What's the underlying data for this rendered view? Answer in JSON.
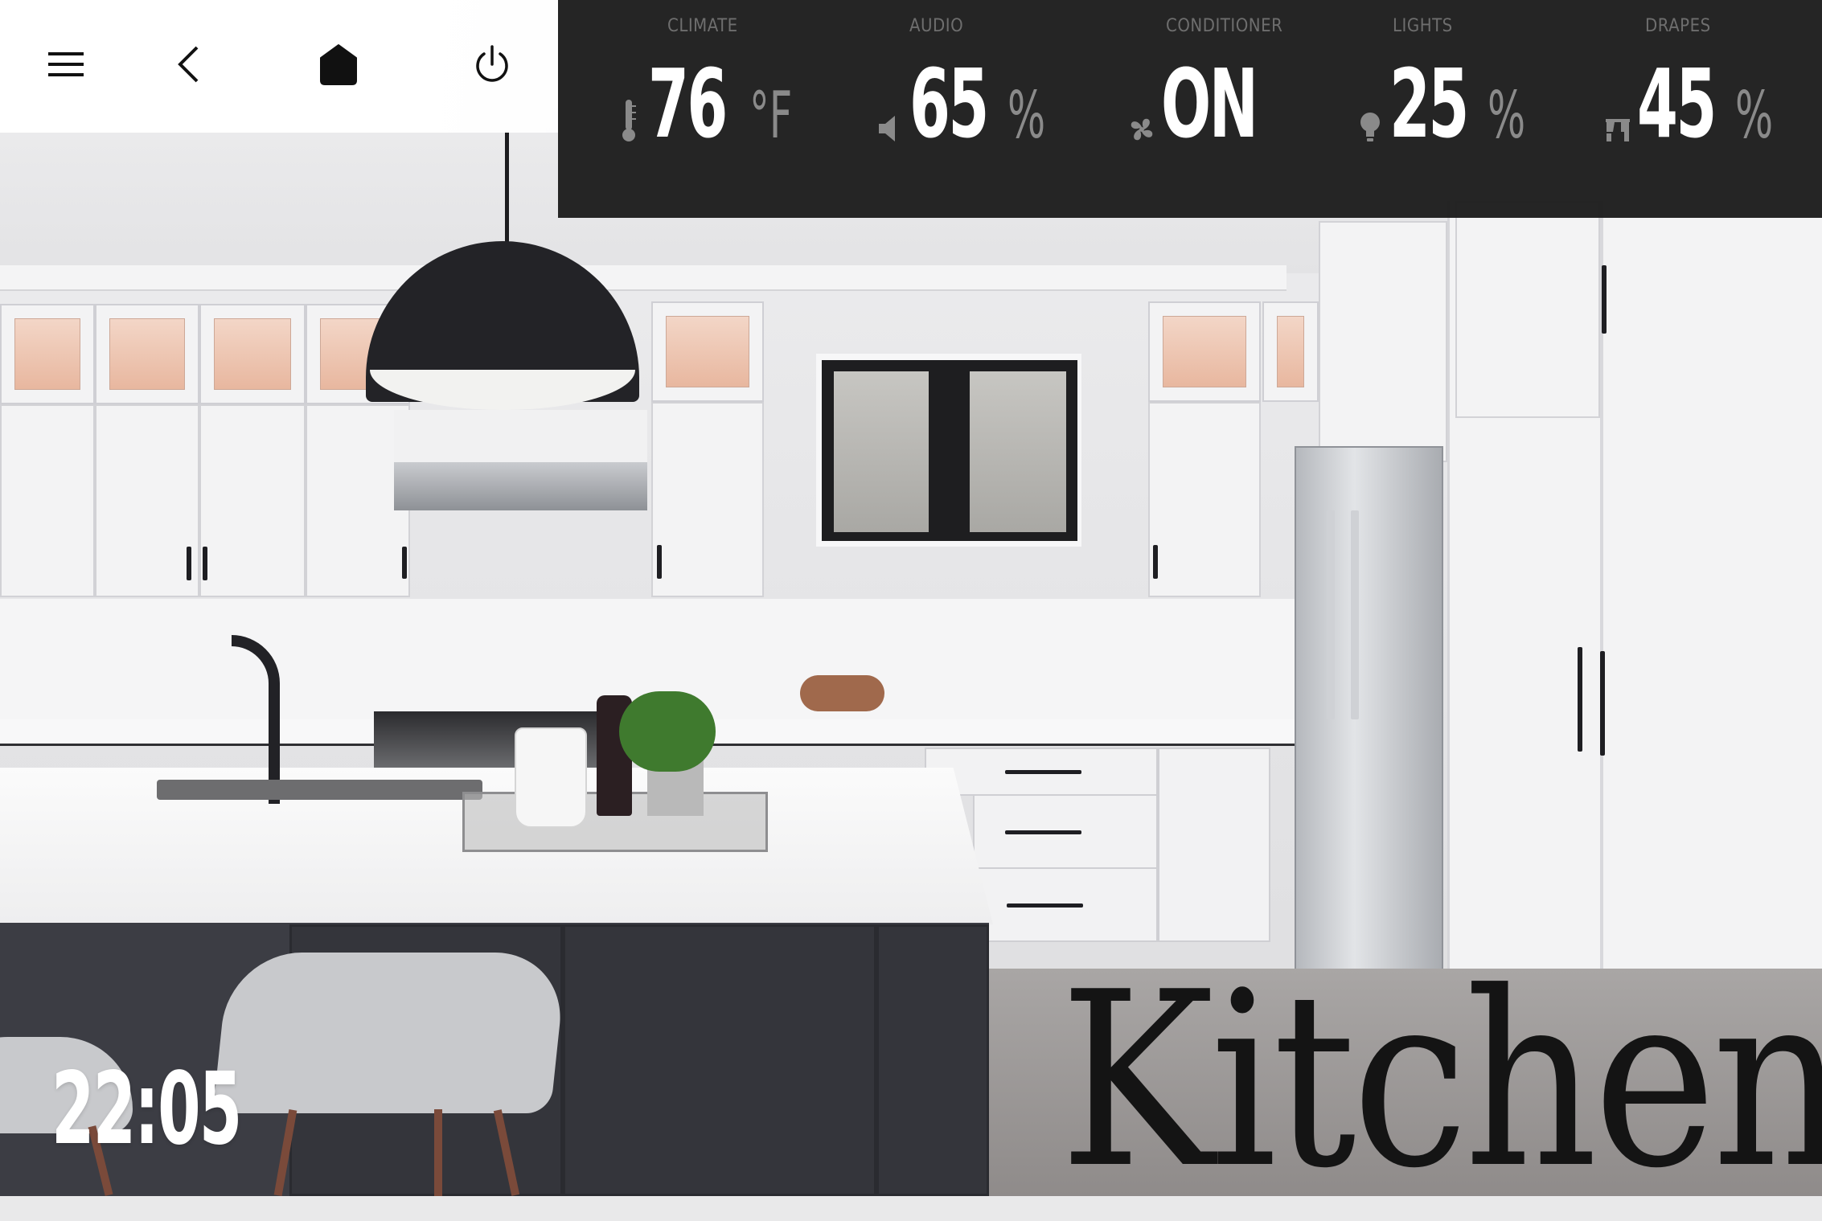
{
  "toolbar": {
    "menu_icon": "hamburger-menu-icon",
    "back_icon": "chevron-left-icon",
    "home_icon": "home-icon",
    "power_icon": "power-icon"
  },
  "status": {
    "items": [
      {
        "label": "CLIMATE",
        "icon": "thermometer-icon",
        "value": "76",
        "unit": "°F"
      },
      {
        "label": "AUDIO",
        "icon": "speaker-icon",
        "value": "65",
        "unit": "%"
      },
      {
        "label": "CONDITIONER",
        "icon": "fan-icon",
        "value": "ON",
        "unit": ""
      },
      {
        "label": "LIGHTS",
        "icon": "bulb-icon",
        "value": "25",
        "unit": "%"
      },
      {
        "label": "DRAPES",
        "icon": "drapes-icon",
        "value": "45",
        "unit": "%"
      }
    ]
  },
  "clock": {
    "time": "22:05"
  },
  "room": {
    "name": "Kitchen"
  },
  "colors": {
    "panel_bg": "#1e1e1e",
    "label": "#6e6e6e",
    "value": "#ffffff",
    "unit": "#8a8a8a",
    "toolbar_bg": "#ffffff"
  }
}
